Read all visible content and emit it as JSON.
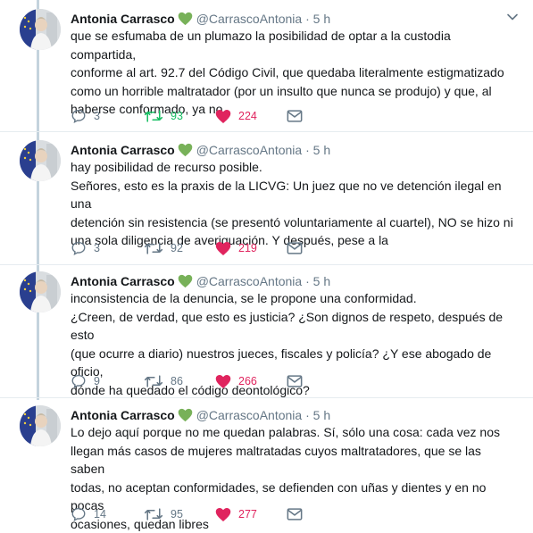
{
  "colors": {
    "retweeted": "#17bf63",
    "liked": "#e0245e",
    "muted": "#657786",
    "thread": "#c4d3dd"
  },
  "tweets": [
    {
      "name": "Antonia Carrasco",
      "badge_icon": "green-heart-icon",
      "handle": "@CarrascoAntonia",
      "sep": "·",
      "time": "5 h",
      "text": "que se esfumaba de un plumazo la posibilidad de optar a la custodia compartida,\nconforme al art. 92.7 del Código Civil, que quedaba literalmente estigmatizado\ncomo un horrible maltratador (por un insulto que nunca se produjo) y que, al\nhaberse conformado, ya no",
      "replies": "3",
      "retweets": "93",
      "likes": "224",
      "retweeted": true
    },
    {
      "name": "Antonia Carrasco",
      "badge_icon": "green-heart-icon",
      "handle": "@CarrascoAntonia",
      "sep": "·",
      "time": "5 h",
      "text": "hay posibilidad de recurso posible.\nSeñores, esto es la praxis de la LICVG: Un juez que no ve detención ilegal en una\ndetención sin resistencia (se presentó voluntariamente al cuartel), NO se hizo ni\nuna sola diligencia de averiguación. Y después, pese a la",
      "replies": "3",
      "retweets": "92",
      "likes": "219",
      "retweeted": false
    },
    {
      "name": "Antonia Carrasco",
      "badge_icon": "green-heart-icon",
      "handle": "@CarrascoAntonia",
      "sep": "·",
      "time": "5 h",
      "text": "inconsistencia de la denuncia, se le propone una conformidad.\n¿Creen, de verdad, que esto es justicia? ¿Son dignos de respeto, después de esto\n(que ocurre a diario) nuestros jueces, fiscales y policía? ¿Y ese abogado de oficio,\ndónde ha quedado el código deontológico?",
      "replies": "9",
      "retweets": "86",
      "likes": "266",
      "retweeted": false
    },
    {
      "name": "Antonia Carrasco",
      "badge_icon": "green-heart-icon",
      "handle": "@CarrascoAntonia",
      "sep": "·",
      "time": "5 h",
      "text": "Lo dejo aquí porque no me quedan palabras. Sí, sólo una cosa: cada vez nos\nllegan más casos de mujeres maltratadas cuyos maltratadores, que se las saben\ntodas, no aceptan conformidades, se defienden con uñas y dientes y en no pocas\nocasiones, quedan libres",
      "replies": "14",
      "retweets": "95",
      "likes": "277",
      "retweeted": false
    }
  ]
}
